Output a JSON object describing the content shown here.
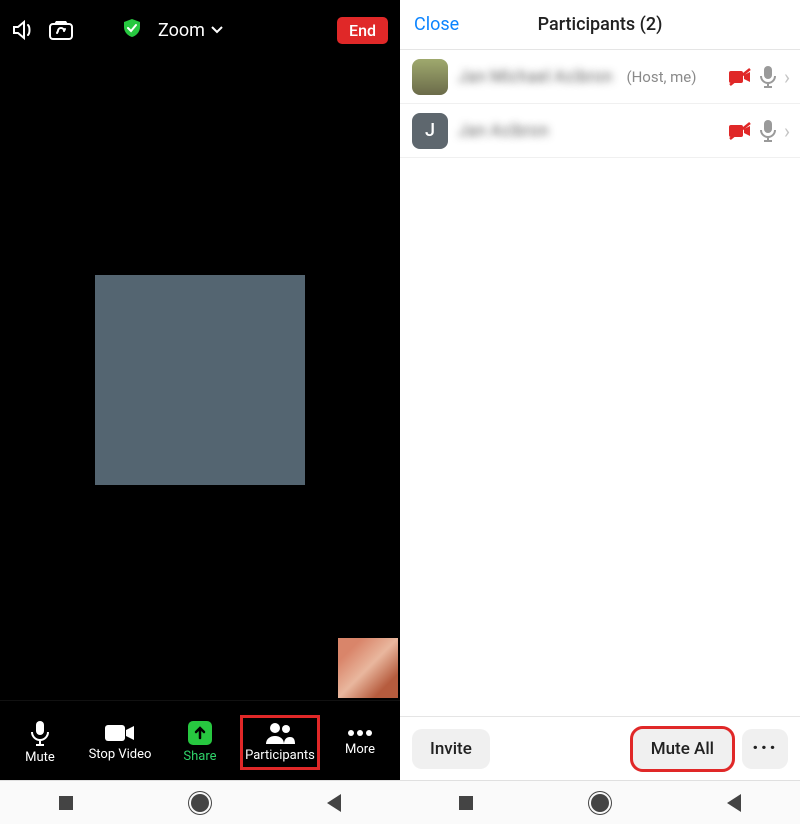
{
  "left": {
    "zoom_label": "Zoom",
    "end_label": "End",
    "tools": {
      "mute": "Mute",
      "stop_video": "Stop Video",
      "share": "Share",
      "participants": "Participants",
      "more": "More"
    }
  },
  "right": {
    "close": "Close",
    "title": "Participants (2)",
    "rows": [
      {
        "name": "Jan Michael Acibron",
        "meta": "(Host, me)",
        "avatar_letter": ""
      },
      {
        "name": "Jan Acibron",
        "meta": "",
        "avatar_letter": "J"
      }
    ],
    "invite": "Invite",
    "mute_all": "Mute All"
  },
  "colors": {
    "red": "#e02828",
    "green": "#2fd269",
    "blue": "#0b84ff"
  }
}
